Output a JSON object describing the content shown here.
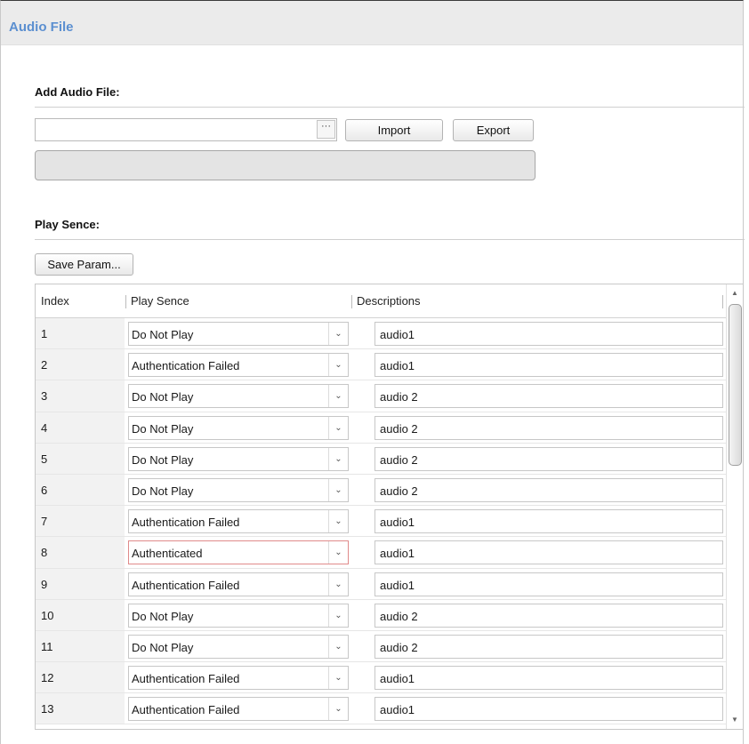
{
  "window": {
    "title": "Audio File"
  },
  "add_section": {
    "label": "Add Audio File:",
    "file_path_value": "",
    "browse_label": "···",
    "import_label": "Import",
    "export_label": "Export",
    "progress": 0
  },
  "play_section": {
    "label": "Play Sence:",
    "save_label": "Save Param..."
  },
  "table": {
    "columns": [
      "Index",
      "Play Sence",
      "Descriptions"
    ],
    "rows": [
      {
        "index": "1",
        "scene": "Do Not Play",
        "description": "audio1"
      },
      {
        "index": "2",
        "scene": "Authentication Failed",
        "description": "audio1"
      },
      {
        "index": "3",
        "scene": "Do Not Play",
        "description": "audio 2"
      },
      {
        "index": "4",
        "scene": "Do Not Play",
        "description": "audio 2"
      },
      {
        "index": "5",
        "scene": "Do Not Play",
        "description": "audio 2"
      },
      {
        "index": "6",
        "scene": "Do Not Play",
        "description": "audio 2"
      },
      {
        "index": "7",
        "scene": "Authentication Failed",
        "description": "audio1"
      },
      {
        "index": "8",
        "scene": "Authenticated",
        "description": "audio1",
        "focused": true
      },
      {
        "index": "9",
        "scene": "Authentication Failed",
        "description": "audio1"
      },
      {
        "index": "10",
        "scene": "Do Not Play",
        "description": "audio 2"
      },
      {
        "index": "11",
        "scene": "Do Not Play",
        "description": "audio 2"
      },
      {
        "index": "12",
        "scene": "Authentication Failed",
        "description": "audio1"
      },
      {
        "index": "13",
        "scene": "Authentication Failed",
        "description": "audio1"
      }
    ]
  },
  "icons": {
    "dropdown": "chevron-down-icon",
    "scroll_up": "scroll-up-arrow-icon",
    "scroll_down": "scroll-down-arrow-icon"
  },
  "colors": {
    "title": "#5b8fd0",
    "focus_border": "#e08a8a",
    "header_bg": "#ebebeb"
  }
}
